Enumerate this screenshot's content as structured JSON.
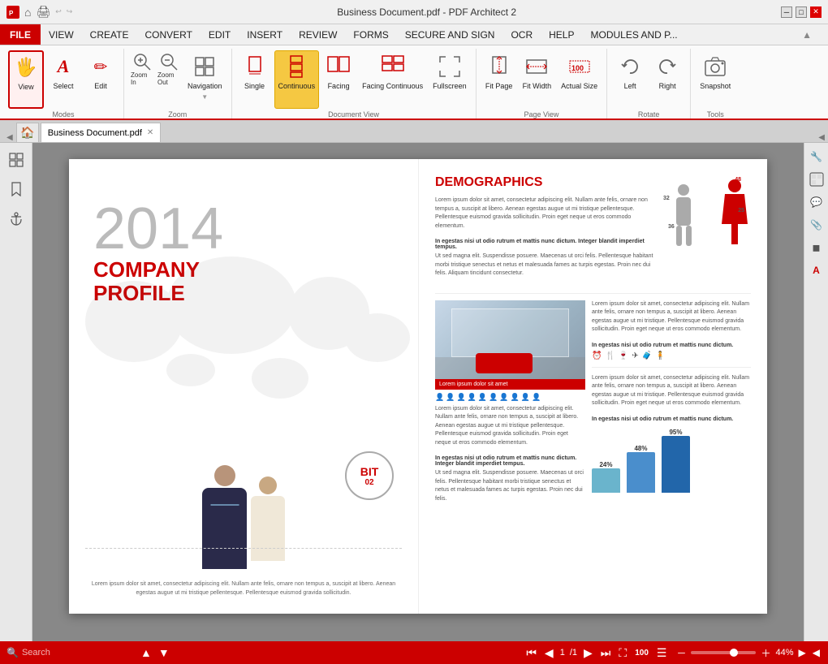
{
  "titlebar": {
    "title": "Business Document.pdf  -  PDF Architect 2",
    "icons": [
      "pdf-icon",
      "home-icon",
      "print-icon",
      "undo-icon",
      "redo-icon"
    ]
  },
  "menubar": {
    "file": "FILE",
    "items": [
      "VIEW",
      "CREATE",
      "CONVERT",
      "EDIT",
      "INSERT",
      "REVIEW",
      "FORMS",
      "SECURE AND SIGN",
      "OCR",
      "HELP",
      "MODULES AND P..."
    ]
  },
  "ribbon": {
    "groups": [
      {
        "label": "Modes",
        "buttons": [
          {
            "id": "view",
            "label": "View",
            "icon": "🖐"
          },
          {
            "id": "select",
            "label": "Select",
            "icon": "A"
          },
          {
            "id": "edit",
            "label": "Edit",
            "icon": "✏️"
          }
        ]
      },
      {
        "label": "Zoom",
        "buttons": [
          {
            "id": "zoom-in",
            "label": "Zoom In",
            "icon": "🔍+"
          },
          {
            "id": "zoom-out",
            "label": "Zoom Out",
            "icon": "🔍-"
          },
          {
            "id": "navigation",
            "label": "Navigation",
            "icon": "⊞"
          }
        ]
      },
      {
        "label": "Document View",
        "buttons": [
          {
            "id": "single",
            "label": "Single",
            "icon": "📄"
          },
          {
            "id": "continuous",
            "label": "Continuous",
            "icon": "📋"
          },
          {
            "id": "facing",
            "label": "Facing",
            "icon": "📖"
          },
          {
            "id": "facing-continuous",
            "label": "Facing Continuous",
            "icon": "📚"
          },
          {
            "id": "fullscreen",
            "label": "Fullscreen",
            "icon": "⛶"
          }
        ]
      },
      {
        "label": "Page View",
        "buttons": [
          {
            "id": "fit-page",
            "label": "Fit Page",
            "icon": "↕"
          },
          {
            "id": "fit-width",
            "label": "Fit Width",
            "icon": "↔"
          },
          {
            "id": "actual-size",
            "label": "Actual Size",
            "icon": "100"
          }
        ]
      },
      {
        "label": "Rotate",
        "buttons": [
          {
            "id": "left",
            "label": "Left",
            "icon": "↺"
          },
          {
            "id": "right",
            "label": "Right",
            "icon": "↻"
          }
        ]
      },
      {
        "label": "Tools",
        "buttons": [
          {
            "id": "snapshot",
            "label": "Snapshot",
            "icon": "📷"
          }
        ]
      }
    ]
  },
  "tabs": {
    "home_icon": "🏠",
    "active_tab": "Business Document.pdf"
  },
  "sidebar": {
    "left_icons": [
      "☰",
      "🔖",
      "⚓"
    ]
  },
  "right_sidebar": {
    "icons": [
      "🔧",
      "👁",
      "📎",
      "◼",
      "A"
    ]
  },
  "document": {
    "left_page": {
      "year": "2014",
      "line1": "COMPANY",
      "line2": "PROFILE",
      "footer_text": "Lorem ipsum dolor sit amet, consectetur adipiscing elit. Nullam ante felis, ornare non tempus a, suscipit at libero. Aenean egestas augue ut mi tristique pellentesque. Pellentesque euismod gravida sollicitudin.",
      "circle_badge": {
        "line1": "BIT",
        "line2": "02"
      }
    },
    "right_page": {
      "section1": {
        "title": "DEMOGRAPHICS",
        "body": "Lorem ipsum dolor sit amet, consectetur adipiscing elit. Nullam ante felis, ornare non tempus a, suscipit at libero. Aenean egestas augue ut mi tristique pellentesque. Pellentesque euismod gravida sollicitudin. Proin eget neque ut eros commodo elementum.",
        "bold_text": "In egestas nisi ut odio rutrum et mattis nunc dictum. Integer blandit imperdiet tempus.",
        "body2": "Ut sed magna elit. Suspendisse posuere. Maecenas ut orci felis. Pellentesque habitant morbi tristique senectus et netus et malesuada fames ac turpis egestas. Proin nec dui felis. Aliquam tincidunt consectetur."
      },
      "section2": {
        "image_caption": "Lorem ipsum dolor sit amet",
        "people_icons": "mixed",
        "body": "Lorem ipsum dolor sit amet, consectetur adipiscing elit. Nullam ante felis, ornare non tempus a, suscipit at libero. Aenean egestas augue ut mi tristique pellentesque. Pellentesque euismod gravida sollicitudin. Proin eget neque ut eros commodo elementum.",
        "bold_text2": "In egestas nisi ut odio rutrum et mattis nunc dictum. Integer blandit imperdiet tempus.",
        "body3": "Ut sed magna elit. Suspendisse posuere. Maecenas ut orci felis. Pellentesque habitant morbi tristique senectus et netus et malesuada fames ac turpis egestas. Proin nec dui felis."
      },
      "stats": {
        "pct1": "24%",
        "pct2": "48%",
        "pct3": "95%"
      },
      "right_text": "Lorem ipsum dolor sit amet, consectetur adipiscing elit. Nullam ante felis, ornare non tempus a, suscipit at libero. Aenean egestas augue ut mi tristique. Pellentesque euismod gravida sollicitudin. Proin eget neque ut eros commodo elementum.",
      "right_text2": "In egestas nisi ut odio rutrum et mattis nunc dictum.",
      "right_text3": "Lorem ipsum dolor sit amet, consectetur adipiscing elit. Nullam ante felis, ornare non tempus a, suscipit at libero. Aenean egestas augue ut mi tristique. Pellentesque euismod gravida sollicitudin. Proin eget neque ut eros commodo elementum.",
      "right_text4": "In egestas nisi ut odio rutrum et mattis nunc dictum."
    }
  },
  "statusbar": {
    "search_placeholder": "Search",
    "page_current": "1",
    "page_total": "/1",
    "zoom_percent": "44%"
  }
}
